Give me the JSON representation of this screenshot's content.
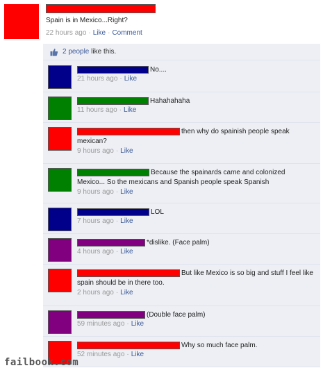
{
  "colors": {
    "red": "#ff0000",
    "blue": "#00008b",
    "green": "#008000",
    "purple": "#800080",
    "link": "#3b5998"
  },
  "post": {
    "text": "Spain is in Mexico...Right?",
    "time": "22 hours ago",
    "like_label": "Like",
    "comment_label": "Comment"
  },
  "likes": {
    "count_link": "2 people",
    "suffix": "like this."
  },
  "like_label": "Like",
  "comments": [
    {
      "color": "red",
      "text": "No....",
      "time": "21 hours ago"
    },
    {
      "color": "green",
      "text": "Hahahahaha",
      "time": "11 hours ago"
    },
    {
      "color": "red",
      "text": "then why do spainish people speak mexican?",
      "time": "9 hours ago"
    },
    {
      "color": "green",
      "text": "Because the spainards came and colonized Mexico... So the mexicans and Spanish people speak Spanish",
      "time": "9 hours ago"
    },
    {
      "color": "blue",
      "text": "LOL",
      "time": "7 hours ago"
    },
    {
      "color": "purple",
      "text": "*dislike. (Face palm)",
      "time": "4 hours ago"
    },
    {
      "color": "red",
      "text": "But like Mexico is so big and stuff I feel like spain should be in there too.",
      "time": "2 hours ago"
    },
    {
      "color": "purple",
      "text": "(Double face palm)",
      "time": "59 minutes ago"
    },
    {
      "color": "red",
      "text": "Why so much face palm.",
      "time": "52 minutes ago"
    }
  ],
  "watermark": "failbook.com"
}
